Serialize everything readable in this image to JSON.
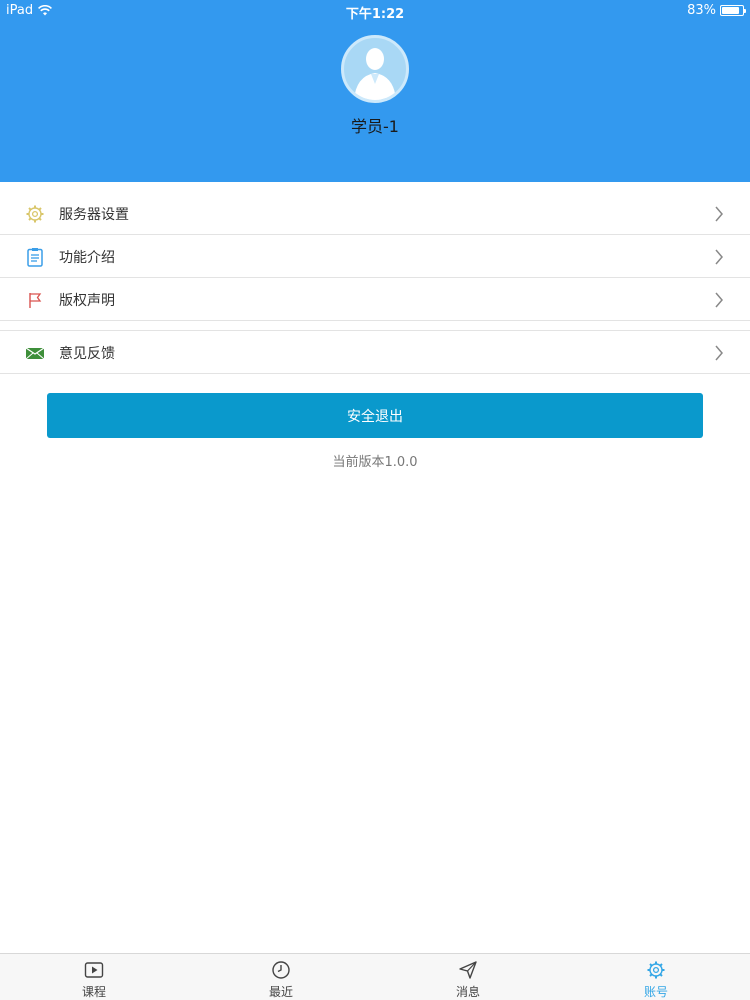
{
  "status_bar": {
    "device": "iPad",
    "time": "下午1:22",
    "battery": "83%",
    "battery_level": 0.83
  },
  "profile": {
    "username": "学员-1"
  },
  "menu": {
    "items": [
      {
        "label": "服务器设置",
        "icon": "gear-icon"
      },
      {
        "label": "功能介绍",
        "icon": "clipboard-icon"
      },
      {
        "label": "版权声明",
        "icon": "flag-icon"
      },
      {
        "label": "意见反馈",
        "icon": "envelope-icon"
      }
    ]
  },
  "logout_button": {
    "label": "安全退出"
  },
  "version_text": "当前版本1.0.0",
  "tabbar": {
    "tabs": [
      {
        "label": "课程",
        "icon": "play-icon"
      },
      {
        "label": "最近",
        "icon": "clock-icon"
      },
      {
        "label": "消息",
        "icon": "paper-plane-icon"
      },
      {
        "label": "账号",
        "icon": "gear-icon",
        "active": true
      }
    ]
  },
  "colors": {
    "header": "#3399ef",
    "accent": "#0a99cc",
    "active_tab": "#33a6e6"
  }
}
